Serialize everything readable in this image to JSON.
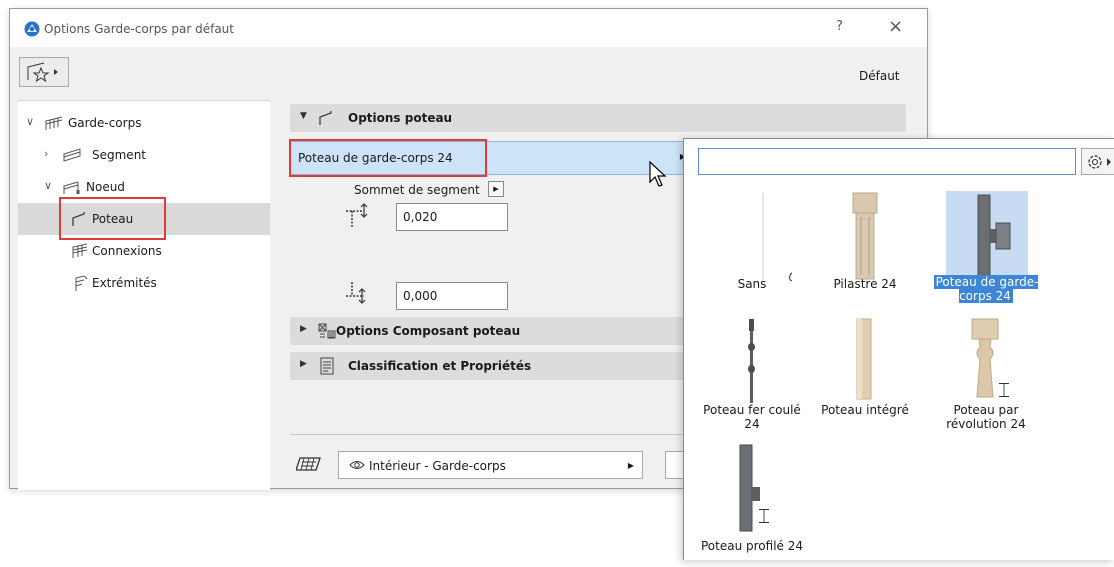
{
  "window": {
    "title": "Options Garde-corps par défaut",
    "help": "?",
    "close": "×",
    "default_label": "Défaut"
  },
  "tree": {
    "items": [
      {
        "label": "Garde-corps",
        "expanded": true,
        "level": 0
      },
      {
        "label": "Segment",
        "expanded": false,
        "level": 1
      },
      {
        "label": "Noeud",
        "expanded": true,
        "level": 1
      },
      {
        "label": "Poteau",
        "selected": true,
        "level": 2
      },
      {
        "label": "Connexions",
        "level": 2
      },
      {
        "label": "Extrémités",
        "level": 2
      }
    ]
  },
  "panel": {
    "section_options_poteau": "Options poteau",
    "picker_value": "Poteau de garde-corps 24",
    "sommet_label": "Sommet de segment",
    "offset_top_value": "0,020",
    "offset_bottom_value": "0,000",
    "section_composant": "Options Composant poteau",
    "section_classification": "Classification et Propriétés",
    "layer_value": "Intérieur - Garde-corps"
  },
  "popup": {
    "search_placeholder": "",
    "items": [
      {
        "label": "Sans"
      },
      {
        "label": "Pilastre 24"
      },
      {
        "label": "Poteau de garde-corps 24",
        "selected": true
      },
      {
        "label": "Poteau fer coulé 24"
      },
      {
        "label": "Poteau intégré"
      },
      {
        "label": "Poteau par révolution 24"
      },
      {
        "label": "Poteau profilé 24"
      }
    ]
  },
  "colors": {
    "selection_blue": "#3d86d6",
    "picker_blue": "#cde3f7",
    "highlight_red": "#e03a3a"
  }
}
